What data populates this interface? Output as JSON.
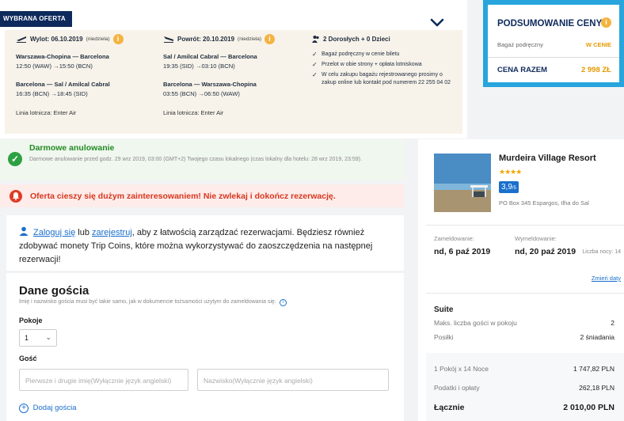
{
  "offer": {
    "badge": "WYBRANA OFERTA",
    "outbound": {
      "label": "Wylot: 06.10.2019",
      "day": "(niedziela)",
      "legs": [
        {
          "route": "Warszawa-Chopina — Barcelona",
          "time": "12:50 (WAW) →15:50 (BCN)"
        },
        {
          "route": "Barcelona — Sal / Amilcal Cabral",
          "time": "16:35 (BCN) →18:45 (SID)"
        }
      ],
      "airline": "Linia lotnicza: Enter Air"
    },
    "return": {
      "label": "Powrót: 20.10.2019",
      "day": "(niedziela)",
      "legs": [
        {
          "route": "Sal / Amilcal Cabral — Barcelona",
          "time": "19:35 (SID) →03:10 (BCN)"
        },
        {
          "route": "Barcelona — Warszawa-Chopina",
          "time": "03:55 (BCN) →06:50 (WAW)"
        }
      ],
      "airline": "Linia lotnicza: Enter Air"
    },
    "travellers": "2 Dorosłych + 0 Dzieci",
    "features": [
      "Bagaż podręczny w cenie biletu",
      "Przelot w obie strony + opłata lotniskowa",
      "W celu zakupu bagażu rejestrowanego prosimy o zakup online lub kontakt pod numerem 22 255 04 02"
    ]
  },
  "price_summary": {
    "title": "PODSUMOWANIE CENY",
    "baggage_label": "Bagaż podręczny",
    "baggage_value": "W CENIE",
    "total_label": "CENA RAZEM",
    "total_value": "2 998 ZŁ"
  },
  "cancellation": {
    "title": "Darmowe anulowanie",
    "text": "Darmowe anulowanie przed godz. 29 wrz 2019, 03:00 (GMT+2) Twojego czasu lokalnego (czas lokalny dla hotelu: 28 wrz 2019, 23:59)."
  },
  "hot_offer": {
    "text": "Oferta cieszy się dużym zainteresowaniem! Nie zwlekaj i dokończ rezerwację."
  },
  "login": {
    "login_link": "Zaloguj się",
    "or": "lub",
    "register_link": "zarejestruj",
    "rest": ", aby z łatwością zarządzać rezerwacjami. Będziesz również zdobywać monety Trip Coins, które można wykorzystywać do zaoszczędzenia na następnej rezerwacji!"
  },
  "guest_form": {
    "title": "Dane gościa",
    "note": "Imię i nazwisko gościa musi być takie samo, jak w dokumencie tożsamości użytym do zameldowania się.",
    "rooms_label": "Pokoje",
    "rooms_value": "1",
    "guest_label": "Gość",
    "first_name_placeholder": "Pierwsze i drugie imię(Wyłącznie język angielski)",
    "last_name_placeholder": "Nazwisko(Wyłącznie język angielski)",
    "add_guest": "Dodaj gościa"
  },
  "hotel": {
    "name": "Murdeira Village Resort",
    "stars": "★★★★",
    "rating": "3,9",
    "rating_sub": "/5",
    "address": "PO Box 345 Espargos, Ilha do Sal",
    "checkin_label": "Zameldowanie:",
    "checkout_label": "Wymeldowanie:",
    "checkin": "nd, 6 paź 2019",
    "checkout": "nd, 20 paź 2019",
    "nights": "Liczba nocy: 14",
    "change_dates": "Zmień daty",
    "room_type": "Suite",
    "max_guests_label": "Maks. liczba gości w pokoju",
    "max_guests": "2",
    "meals_label": "Posiłki",
    "meals": "2 śniadania",
    "cost_label": "1 Pokój x 14 Noce",
    "cost": "1 747,82 PLN",
    "taxes_label": "Podatki i opłaty",
    "taxes": "262,18 PLN",
    "total_label": "Łącznie",
    "total": "2 010,00 PLN"
  },
  "colors": {
    "accent": "#27a5dc",
    "navy": "#0e2a5c",
    "orange": "#e59a00",
    "green": "#2ea043",
    "red": "#e03b24",
    "link": "#1a6fcc"
  }
}
